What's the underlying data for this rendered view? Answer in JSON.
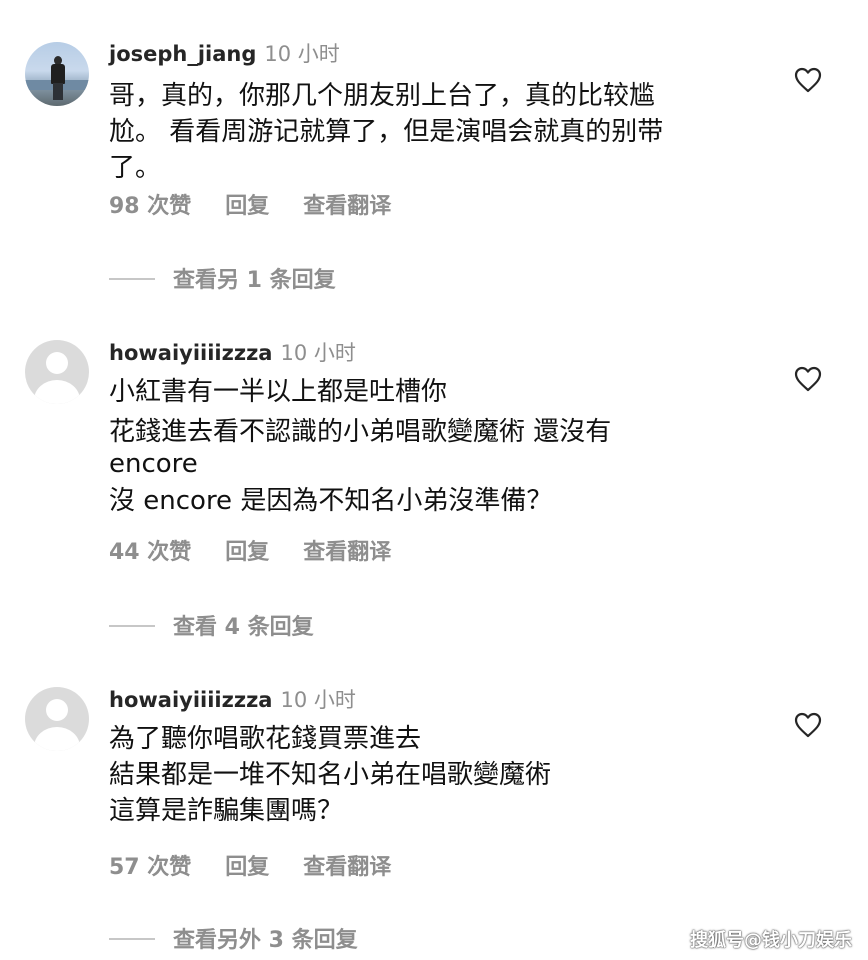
{
  "comments": [
    {
      "username": "joseph_jiang",
      "time": "10 小时",
      "lines": [
        "哥，真的，你那几个朋友别上台了，真的比较尴",
        "尬。 看看周游记就算了，但是演唱会就真的别带",
        "了。"
      ],
      "likes": "98 次赞",
      "reply": "回复",
      "translate": "查看翻译",
      "view_replies": "查看另 1 条回复",
      "avatar": "photo"
    },
    {
      "username": "howaiyiiiizzza",
      "time": "10 小时",
      "lines": [
        "小紅書有一半以上都是吐槽你",
        "花錢進去看不認識的小弟唱歌變魔術 還沒有",
        "encore",
        "沒 encore 是因為不知名小弟沒準備？"
      ],
      "likes": "44 次赞",
      "reply": "回复",
      "translate": "查看翻译",
      "view_replies": "查看 4 条回复",
      "avatar": "placeholder"
    },
    {
      "username": "howaiyiiiizzza",
      "time": "10 小时",
      "lines": [
        "為了聽你唱歌花錢買票進去",
        "結果都是一堆不知名小弟在唱歌變魔術",
        "這算是詐騙集團嗎？"
      ],
      "likes": "57 次赞",
      "reply": "回复",
      "translate": "查看翻译",
      "view_replies": "查看另外 3 条回复",
      "avatar": "placeholder"
    }
  ],
  "watermark": "搜狐号@钱小刀娱乐",
  "icons": {
    "like": "heart-outline-icon",
    "avatar_default": "default-avatar-icon"
  },
  "colors": {
    "text": "#111111",
    "secondary": "#8e8e8e",
    "divider": "#c7c7c7"
  }
}
